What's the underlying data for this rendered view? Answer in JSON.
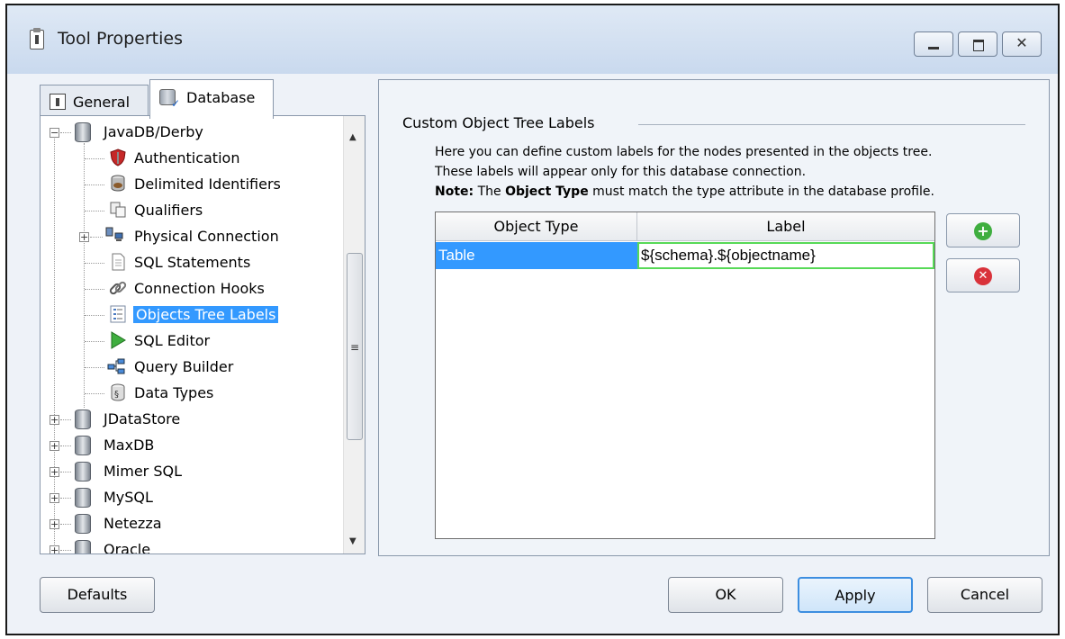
{
  "window": {
    "title": "Tool Properties"
  },
  "tabs": [
    {
      "label": "General",
      "icon": "clipboard-icon"
    },
    {
      "label": "Database",
      "icon": "database-check-icon"
    }
  ],
  "tree": {
    "items": [
      {
        "label": "JavaDB/Derby",
        "icon": "database-icon",
        "expanded": true
      },
      {
        "label": "Authentication",
        "icon": "shield-icon"
      },
      {
        "label": "Delimited Identifiers",
        "icon": "cylinder-icon"
      },
      {
        "label": "Qualifiers",
        "icon": "qualifier-icon"
      },
      {
        "label": "Physical Connection",
        "icon": "network-icon"
      },
      {
        "label": "SQL Statements",
        "icon": "document-icon"
      },
      {
        "label": "Connection Hooks",
        "icon": "chain-link-icon"
      },
      {
        "label": "Objects Tree Labels",
        "icon": "tree-labels-icon",
        "selected": true
      },
      {
        "label": "SQL Editor",
        "icon": "play-icon"
      },
      {
        "label": "Query Builder",
        "icon": "query-builder-icon"
      },
      {
        "label": "Data Types",
        "icon": "data-types-icon"
      },
      {
        "label": "JDataStore",
        "icon": "database-icon"
      },
      {
        "label": "MaxDB",
        "icon": "database-icon"
      },
      {
        "label": "Mimer SQL",
        "icon": "database-icon"
      },
      {
        "label": "MySQL",
        "icon": "database-icon"
      },
      {
        "label": "Netezza",
        "icon": "database-icon"
      },
      {
        "label": "Oracle",
        "icon": "database-icon"
      }
    ]
  },
  "panel": {
    "group_title": "Custom Object Tree Labels",
    "desc_line1": "Here you can define custom labels for the nodes presented in the objects tree.",
    "desc_line2": "These labels will appear only for this database connection.",
    "note_prefix": "Note:",
    "note_mid1": " The ",
    "note_bold": "Object Type",
    "note_rest": " must match the type attribute in the database profile.",
    "table": {
      "headers": [
        "Object Type",
        "Label"
      ],
      "rows": [
        {
          "object_type": "Table",
          "label": "${schema}.${objectname}"
        }
      ]
    }
  },
  "buttons": {
    "defaults": "Defaults",
    "ok": "OK",
    "apply": "Apply",
    "cancel": "Cancel"
  },
  "colors": {
    "selection": "#3399ff",
    "add": "#3fae3f",
    "remove": "#d9323a"
  }
}
